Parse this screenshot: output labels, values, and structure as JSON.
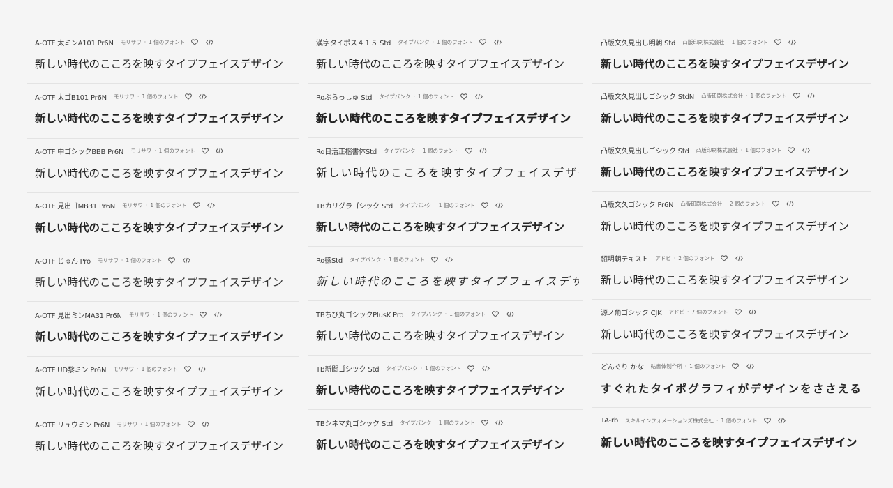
{
  "columns": [
    {
      "cards": [
        {
          "name": "A-OTF 太ミンA101 Pr6N",
          "foundry": "モリサワ",
          "count": "1 個のフォント",
          "sample": "新しい時代のこころを映すタイプフェイスデザイン",
          "style": "w-serif"
        },
        {
          "name": "A-OTF 太ゴB101 Pr6N",
          "foundry": "モリサワ",
          "count": "1 個のフォント",
          "sample": "新しい時代のこころを映すタイプフェイスデザイン",
          "style": "w-bold"
        },
        {
          "name": "A-OTF 中ゴシックBBB Pr6N",
          "foundry": "モリサワ",
          "count": "1 個のフォント",
          "sample": "新しい時代のこころを映すタイプフェイスデザイン",
          "style": "w-normal"
        },
        {
          "name": "A-OTF 見出ゴMB31 Pr6N",
          "foundry": "モリサワ",
          "count": "1 個のフォント",
          "sample": "新しい時代のこころを映すタイプフェイスデザイン",
          "style": "w-bold"
        },
        {
          "name": "A-OTF じゅん Pro",
          "foundry": "モリサワ",
          "count": "1 個のフォント",
          "sample": "新しい時代のこころを映すタイプフェイスデザイン",
          "style": "w-thin"
        },
        {
          "name": "A-OTF 見出ミンMA31 Pr6N",
          "foundry": "モリサワ",
          "count": "1 個のフォント",
          "sample": "新しい時代のこころを映すタイプフェイスデザイン",
          "style": "w-serif-bold"
        },
        {
          "name": "A-OTF UD黎ミン Pr6N",
          "foundry": "モリサワ",
          "count": "1 個のフォント",
          "sample": "新しい時代のこころを映すタイプフェイスデザイン",
          "style": "w-serif"
        },
        {
          "name": "A-OTF リュウミン Pr6N",
          "foundry": "モリサワ",
          "count": "1 個のフォント",
          "sample": "新しい時代のこころを映すタイプフェイスデザイン",
          "style": "w-serif"
        }
      ]
    },
    {
      "cards": [
        {
          "name": "漢字タイポス４１５ Std",
          "foundry": "タイプバンク",
          "count": "1 個のフォント",
          "sample": "新しい時代のこころを映すタイプフェイスデザイン",
          "style": "w-normal"
        },
        {
          "name": "Roぶらっしゅ Std",
          "foundry": "タイプバンク",
          "count": "1 個のフォント",
          "sample": "新しい時代のこころを映すタイプフェイスデザイン",
          "style": "w-heavy"
        },
        {
          "name": "Ro日活正楷書体Std",
          "foundry": "タイプバンク",
          "count": "1 個のフォント",
          "sample": "新しい時代のこころを映すタイプフェイスデザイン",
          "style": "w-serif w-wide"
        },
        {
          "name": "TBカリグラゴシック Std",
          "foundry": "タイプバンク",
          "count": "1 個のフォント",
          "sample": "新しい時代のこころを映すタイプフェイスデザイン",
          "style": "w-bold"
        },
        {
          "name": "Ro篠Std",
          "foundry": "タイプバンク",
          "count": "1 個のフォント",
          "sample": "新しい時代のこころを映すタイプフェイスデザイン",
          "style": "w-italic w-wider"
        },
        {
          "name": "TBちび丸ゴシックPlusK Pro",
          "foundry": "タイプバンク",
          "count": "1 個のフォント",
          "sample": "新しい時代のこころを映すタイプフェイスデザイン",
          "style": "w-normal"
        },
        {
          "name": "TB新聞ゴシック Std",
          "foundry": "タイプバンク",
          "count": "1 個のフォント",
          "sample": "新しい時代のこころを映すタイプフェイスデザイン",
          "style": "w-bold"
        },
        {
          "name": "TBシネマ丸ゴシック Std",
          "foundry": "タイプバンク",
          "count": "1 個のフォント",
          "sample": "新しい時代のこころを映すタイプフェイスデザイン",
          "style": "w-bold"
        }
      ]
    },
    {
      "cards": [
        {
          "name": "凸版文久見出し明朝 Std",
          "foundry": "凸版印刷株式会社",
          "count": "1 個のフォント",
          "sample": "新しい時代のこころを映すタイプフェイスデザイン",
          "style": "w-serif-bold"
        },
        {
          "name": "凸版文久見出しゴシック StdN",
          "foundry": "凸版印刷株式会社",
          "count": "1 個のフォント",
          "sample": "新しい時代のこころを映すタイプフェイスデザイン",
          "style": "w-bold"
        },
        {
          "name": "凸版文久見出しゴシック Std",
          "foundry": "凸版印刷株式会社",
          "count": "1 個のフォント",
          "sample": "新しい時代のこころを映すタイプフェイスデザイン",
          "style": "w-bold"
        },
        {
          "name": "凸版文久ゴシック Pr6N",
          "foundry": "凸版印刷株式会社",
          "count": "2 個のフォント",
          "sample": "新しい時代のこころを映すタイプフェイスデザイン",
          "style": "w-normal"
        },
        {
          "name": "貂明朝テキスト",
          "foundry": "アドビ",
          "count": "2 個のフォント",
          "sample": "新しい時代のこころを映すタイプフェイスデザイン",
          "style": "w-serif"
        },
        {
          "name": "源ノ角ゴシック CJK",
          "foundry": "アドビ",
          "count": "7 個のフォント",
          "sample": "新しい時代のこころを映すタイプフェイスデザイン",
          "style": "w-normal"
        },
        {
          "name": "どんぐり かな",
          "foundry": "砧書体制作所",
          "count": "1 個のフォント",
          "sample": "すぐれたタイポグラフィがデザインをささえる",
          "style": "w-bold w-wide"
        },
        {
          "name": "TA-rb",
          "foundry": "スキルインフォメーションズ株式会社",
          "count": "1 個のフォント",
          "sample": "新しい時代のこころを映すタイプフェイスデザイン",
          "style": "w-display"
        }
      ]
    }
  ],
  "icons": {
    "favorite": "heart-icon",
    "embed": "code-icon"
  },
  "colors": {
    "background": "#f5f5f5",
    "divider": "#e3e3e3",
    "text": "#2c2c2c",
    "meta": "#6e6e6e"
  }
}
